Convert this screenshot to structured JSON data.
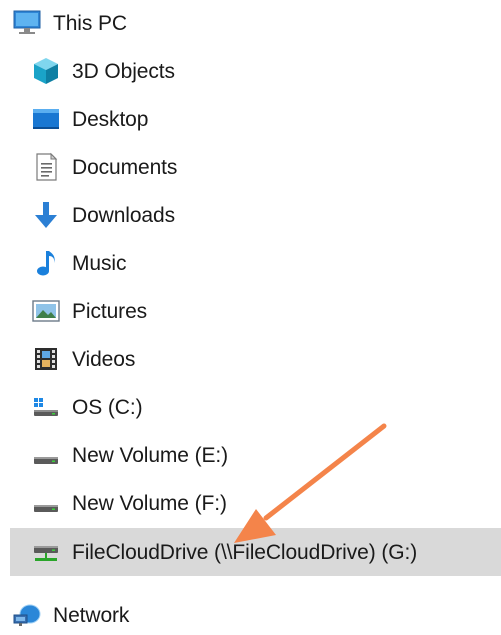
{
  "nav_tree": {
    "root": {
      "label": "This PC",
      "icon": "computer-icon"
    },
    "items": [
      {
        "label": "3D Objects",
        "icon": "3d-objects-icon"
      },
      {
        "label": "Desktop",
        "icon": "desktop-icon"
      },
      {
        "label": "Documents",
        "icon": "documents-icon"
      },
      {
        "label": "Downloads",
        "icon": "downloads-icon"
      },
      {
        "label": "Music",
        "icon": "music-icon"
      },
      {
        "label": "Pictures",
        "icon": "pictures-icon"
      },
      {
        "label": "Videos",
        "icon": "videos-icon"
      },
      {
        "label": "OS (C:)",
        "icon": "os-drive-icon"
      },
      {
        "label": "New Volume (E:)",
        "icon": "drive-icon"
      },
      {
        "label": "New Volume (F:)",
        "icon": "drive-icon"
      },
      {
        "label": "FileCloudDrive (\\\\FileCloudDrive) (G:)",
        "icon": "network-drive-icon",
        "selected": true
      }
    ],
    "network": {
      "label": "Network",
      "icon": "network-icon"
    }
  },
  "colors": {
    "selection_background": "#d9d9d9",
    "annotation_arrow": "#f4844a",
    "text": "#1a1a1a"
  }
}
